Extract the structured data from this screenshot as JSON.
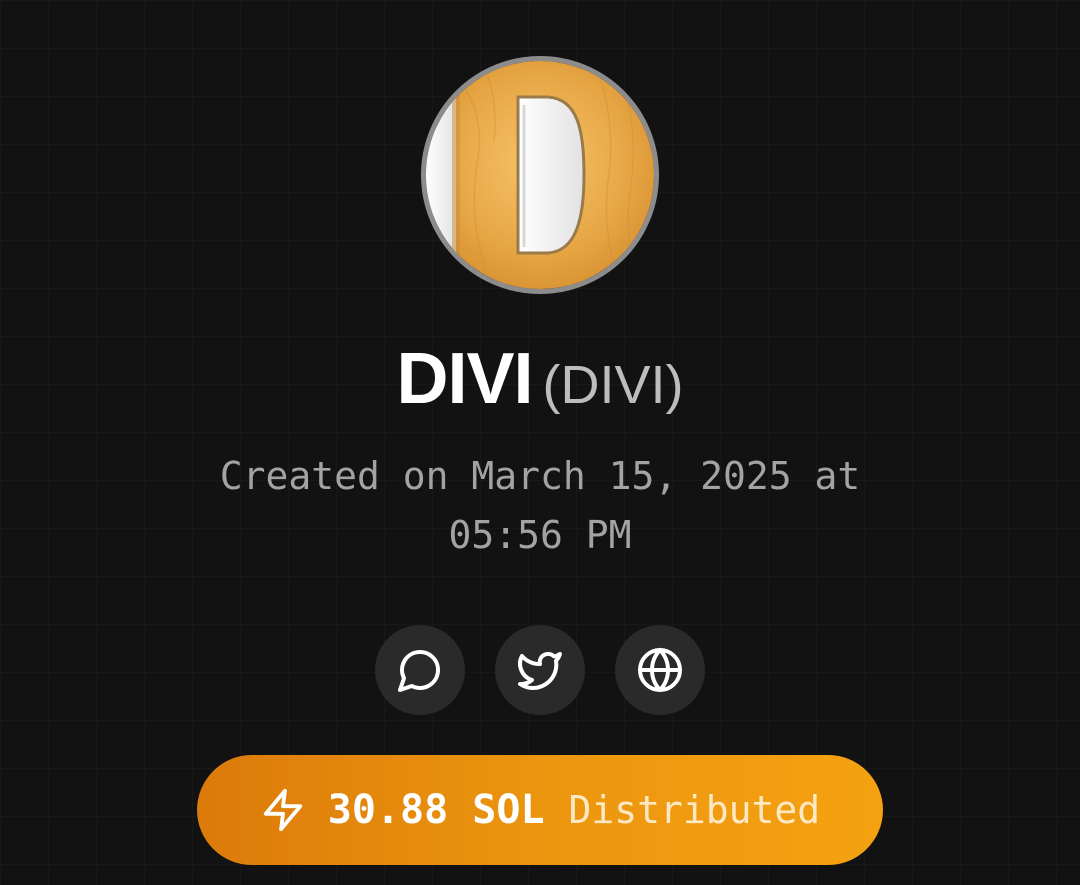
{
  "token": {
    "name": "DIVI",
    "symbol": "(DIVI)",
    "avatar_icon": "letter-d-logo",
    "created_line1": "Created on March 15, 2025 at",
    "created_line2": "05:56 PM"
  },
  "links": [
    {
      "icon": "chat-icon"
    },
    {
      "icon": "twitter-icon"
    },
    {
      "icon": "globe-icon"
    }
  ],
  "distribution": {
    "icon": "lightning-icon",
    "amount": "30.88 SOL",
    "label": "Distributed"
  },
  "colors": {
    "background": "#121212",
    "accent_start": "#dc7a0a",
    "accent_end": "#f5a211",
    "button_bg": "#2a2a2a",
    "muted_text": "#a3a3a3"
  }
}
